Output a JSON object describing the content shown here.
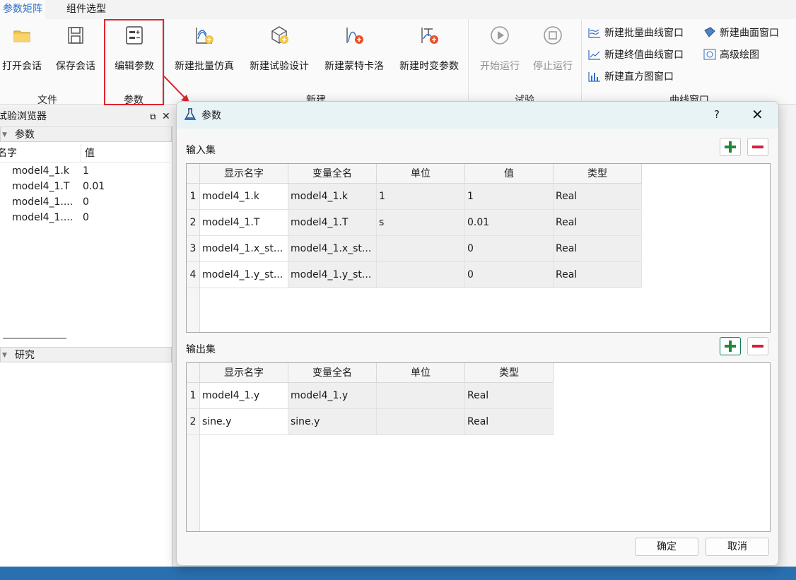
{
  "ribbon": {
    "tabs": [
      {
        "label": "参数矩阵",
        "active": true
      },
      {
        "label": "组件选型",
        "active": false
      }
    ],
    "buttons": {
      "open_session": "打开会话",
      "save_session": "保存会话",
      "edit_params": "编辑参数",
      "new_batch_sim": "新建批量仿真",
      "new_experiment": "新建试验设计",
      "new_monte_carlo": "新建蒙特卡洛",
      "new_time_varying": "新建时变参数",
      "start_run": "开始运行",
      "stop_run": "停止运行"
    },
    "curve_buttons": {
      "batch_curve": "新建批量曲线窗口",
      "surface": "新建曲面窗口",
      "final_value_curve": "新建终值曲线窗口",
      "advanced_plot": "高级绘图",
      "histogram": "新建直方图窗口"
    },
    "groups": {
      "file": "文件",
      "params": "参数",
      "new": "新建",
      "experiment": "试验",
      "curve_window": "曲线窗口"
    },
    "highlight_color": "#e0242e"
  },
  "browser": {
    "title": "试验浏览器",
    "params_section": "参数",
    "col_name": "名字",
    "col_value": "值",
    "rows": [
      {
        "name": "model4_1.k",
        "value": "1"
      },
      {
        "name": "model4_1.T",
        "value": "0.01"
      },
      {
        "name": "model4_1....",
        "value": "0"
      },
      {
        "name": "model4_1....",
        "value": "0"
      }
    ],
    "study_section": "研究"
  },
  "dialog": {
    "title": "参数",
    "help": "?",
    "input_label": "输入集",
    "output_label": "输出集",
    "input_headers": [
      "显示名字",
      "变量全名",
      "单位",
      "值",
      "类型"
    ],
    "input_rows": [
      {
        "n": "1",
        "display": "model4_1.k",
        "full": "model4_1.k",
        "unit": "1",
        "value": "1",
        "type": "Real"
      },
      {
        "n": "2",
        "display": "model4_1.T",
        "full": "model4_1.T",
        "unit": "s",
        "value": "0.01",
        "type": "Real"
      },
      {
        "n": "3",
        "display": "model4_1.x_st...",
        "full": "model4_1.x_st...",
        "unit": "",
        "value": "0",
        "type": "Real"
      },
      {
        "n": "4",
        "display": "model4_1.y_st...",
        "full": "model4_1.y_st...",
        "unit": "",
        "value": "0",
        "type": "Real"
      }
    ],
    "output_headers": [
      "显示名字",
      "变量全名",
      "单位",
      "类型"
    ],
    "output_rows": [
      {
        "n": "1",
        "display": "model4_1.y",
        "full": "model4_1.y",
        "unit": "",
        "type": "Real"
      },
      {
        "n": "2",
        "display": "sine.y",
        "full": "sine.y",
        "unit": "",
        "type": "Real"
      }
    ],
    "ok": "确定",
    "cancel": "取消",
    "plus_color": "#1e8a3a",
    "minus_color": "#d61f3a"
  }
}
